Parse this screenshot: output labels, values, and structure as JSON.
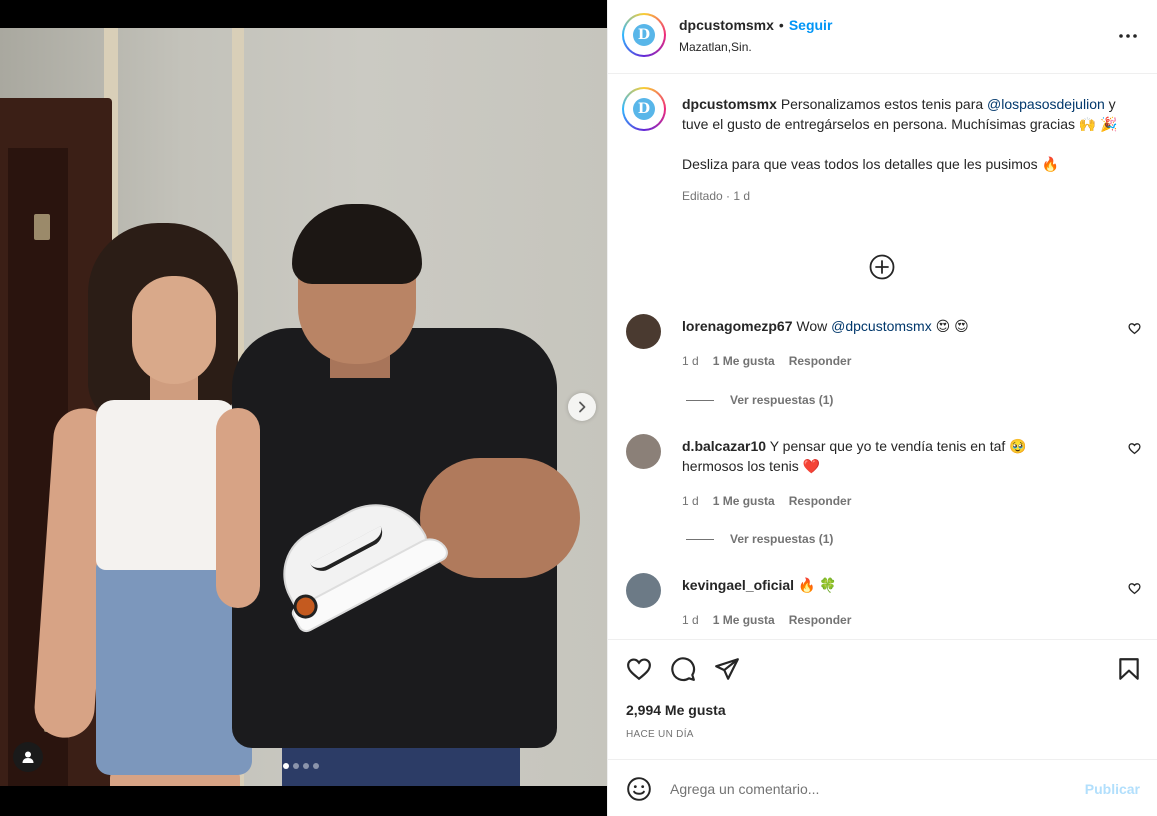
{
  "post": {
    "author": "dpcustomsmx",
    "follow_label": "Seguir",
    "location": "Mazatlan,Sin.",
    "separator": "•"
  },
  "media": {
    "slide_count": 4,
    "active_slide": 1
  },
  "caption": {
    "username": "dpcustomsmx",
    "text_1": "Personalizamos estos tenis para",
    "mention": "@lospasosdejulion",
    "text_2": "y tuve el gusto de entregárselos en persona. Muchísimas gracias 🙌 🎉",
    "text_3": "Desliza para que veas todos los detalles que les pusimos 🔥",
    "meta": "Editado · 1 d"
  },
  "comments": [
    {
      "username": "lorenagomezp67",
      "text_1": "Wow",
      "mention": "@dpcustomsmx",
      "text_2": "😍 😍",
      "time": "1 d",
      "likes": "1 Me gusta",
      "reply": "Responder",
      "view_replies": "Ver respuestas (1)"
    },
    {
      "username": "d.balcazar10",
      "text": "Y pensar que yo te vendía tenis en taf 🥹 hermosos los tenis ❤️",
      "time": "1 d",
      "likes": "1 Me gusta",
      "reply": "Responder",
      "view_replies": "Ver respuestas (1)"
    },
    {
      "username": "kevingael_oficial",
      "text": "🔥 🍀",
      "time": "1 d",
      "likes": "1 Me gusta",
      "reply": "Responder"
    }
  ],
  "engagement": {
    "likes": "2,994 Me gusta",
    "posted_ago": "HACE UN DÍA"
  },
  "add_comment": {
    "placeholder": "Agrega un comentario...",
    "publish_label": "Publicar"
  },
  "colors": {
    "accent": "#0095f6",
    "mention": "#00376b",
    "heart_red": "#ed4956",
    "publish_disabled": "#b2dffc"
  },
  "icons": {
    "like": "heart-icon",
    "comment": "comment-icon",
    "share": "send-icon",
    "save": "bookmark-icon",
    "more": "more-horizontal-icon",
    "emoji": "emoji-icon",
    "new": "plus-circle-icon",
    "next": "chevron-right-icon",
    "tags": "user-tag-icon"
  }
}
